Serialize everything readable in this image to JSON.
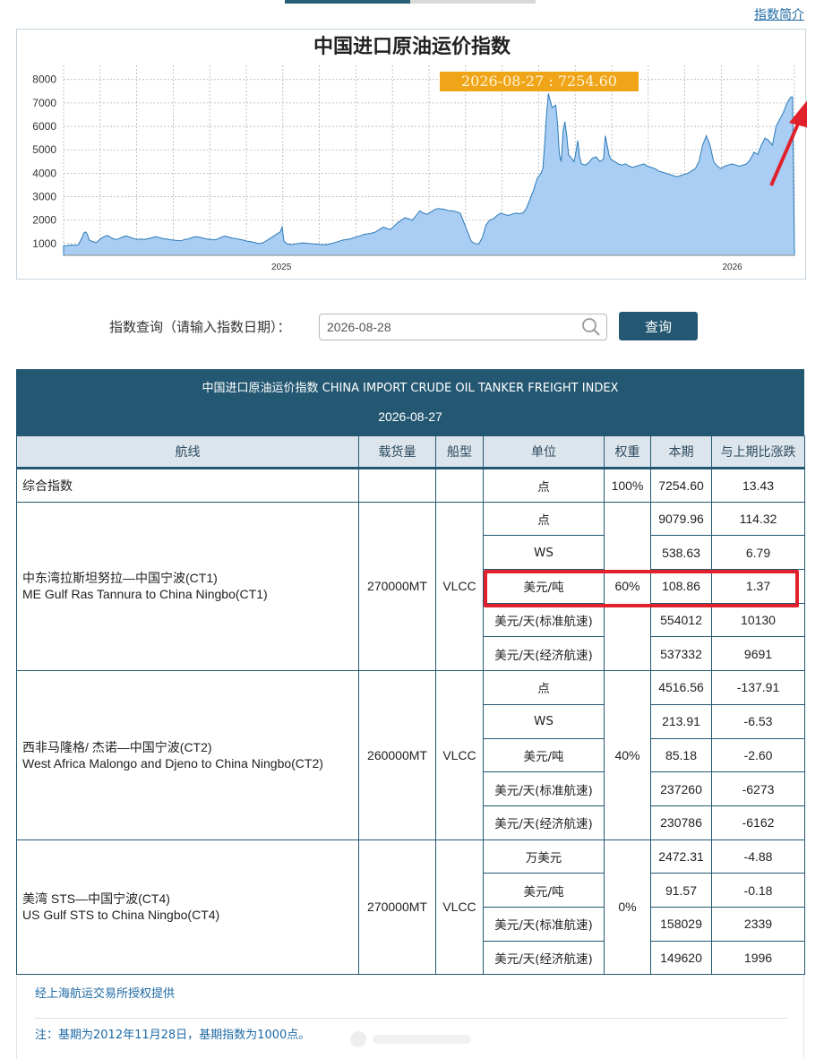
{
  "top": {
    "intro_link": "指数简介"
  },
  "chart_data": {
    "type": "area",
    "title": "中国进口原油运价指数",
    "yticks": [
      1000,
      2000,
      3000,
      4000,
      5000,
      6000,
      7000,
      8000
    ],
    "xticks": [
      "2025",
      "2026"
    ],
    "ylim": [
      500,
      8600
    ],
    "tooltip": "2026-08-27 : 7254.60",
    "fill_color": "#a9cdf3",
    "line_color": "#2b7bb9",
    "points": [
      [
        0,
        900
      ],
      [
        2,
        910
      ],
      [
        4,
        940
      ],
      [
        6,
        930
      ],
      [
        8,
        950
      ],
      [
        10,
        1250
      ],
      [
        11,
        1450
      ],
      [
        12,
        1500
      ],
      [
        13,
        1380
      ],
      [
        14,
        1150
      ],
      [
        16,
        1080
      ],
      [
        18,
        1050
      ],
      [
        20,
        1200
      ],
      [
        22,
        1300
      ],
      [
        24,
        1350
      ],
      [
        26,
        1250
      ],
      [
        28,
        1180
      ],
      [
        30,
        1200
      ],
      [
        32,
        1280
      ],
      [
        34,
        1330
      ],
      [
        36,
        1280
      ],
      [
        38,
        1220
      ],
      [
        40,
        1180
      ],
      [
        42,
        1200
      ],
      [
        44,
        1180
      ],
      [
        46,
        1210
      ],
      [
        48,
        1250
      ],
      [
        50,
        1300
      ],
      [
        52,
        1260
      ],
      [
        54,
        1220
      ],
      [
        56,
        1200
      ],
      [
        58,
        1170
      ],
      [
        60,
        1150
      ],
      [
        62,
        1130
      ],
      [
        64,
        1120
      ],
      [
        66,
        1180
      ],
      [
        68,
        1200
      ],
      [
        70,
        1260
      ],
      [
        72,
        1300
      ],
      [
        74,
        1270
      ],
      [
        76,
        1230
      ],
      [
        78,
        1200
      ],
      [
        80,
        1180
      ],
      [
        82,
        1160
      ],
      [
        84,
        1200
      ],
      [
        86,
        1280
      ],
      [
        88,
        1320
      ],
      [
        90,
        1280
      ],
      [
        92,
        1230
      ],
      [
        94,
        1210
      ],
      [
        96,
        1180
      ],
      [
        98,
        1150
      ],
      [
        100,
        1100
      ],
      [
        102,
        1080
      ],
      [
        104,
        1050
      ],
      [
        106,
        1000
      ],
      [
        108,
        1020
      ],
      [
        110,
        1100
      ],
      [
        112,
        1200
      ],
      [
        114,
        1300
      ],
      [
        116,
        1400
      ],
      [
        118,
        1500
      ],
      [
        119,
        1700
      ],
      [
        120,
        1100
      ],
      [
        122,
        980
      ],
      [
        124,
        960
      ],
      [
        126,
        980
      ],
      [
        128,
        1010
      ],
      [
        130,
        1030
      ],
      [
        132,
        1020
      ],
      [
        134,
        1000
      ],
      [
        136,
        990
      ],
      [
        138,
        980
      ],
      [
        140,
        960
      ],
      [
        142,
        950
      ],
      [
        144,
        970
      ],
      [
        146,
        1000
      ],
      [
        148,
        1050
      ],
      [
        150,
        1100
      ],
      [
        152,
        1150
      ],
      [
        154,
        1180
      ],
      [
        156,
        1200
      ],
      [
        158,
        1250
      ],
      [
        160,
        1300
      ],
      [
        162,
        1350
      ],
      [
        164,
        1400
      ],
      [
        166,
        1420
      ],
      [
        168,
        1450
      ],
      [
        170,
        1500
      ],
      [
        172,
        1600
      ],
      [
        174,
        1700
      ],
      [
        176,
        1650
      ],
      [
        178,
        1600
      ],
      [
        180,
        1750
      ],
      [
        182,
        1900
      ],
      [
        184,
        2000
      ],
      [
        186,
        2100
      ],
      [
        188,
        2050
      ],
      [
        190,
        2000
      ],
      [
        192,
        2200
      ],
      [
        194,
        2400
      ],
      [
        196,
        2300
      ],
      [
        198,
        2250
      ],
      [
        200,
        2350
      ],
      [
        202,
        2450
      ],
      [
        204,
        2500
      ],
      [
        206,
        2480
      ],
      [
        208,
        2450
      ],
      [
        210,
        2400
      ],
      [
        212,
        2400
      ],
      [
        214,
        2350
      ],
      [
        216,
        2300
      ],
      [
        218,
        1900
      ],
      [
        220,
        1500
      ],
      [
        222,
        1100
      ],
      [
        224,
        1000
      ],
      [
        226,
        980
      ],
      [
        228,
        1250
      ],
      [
        230,
        1800
      ],
      [
        232,
        2000
      ],
      [
        234,
        2050
      ],
      [
        236,
        2200
      ],
      [
        238,
        2300
      ],
      [
        240,
        2250
      ],
      [
        242,
        2200
      ],
      [
        244,
        2250
      ],
      [
        246,
        2300
      ],
      [
        248,
        2280
      ],
      [
        250,
        2300
      ],
      [
        252,
        2500
      ],
      [
        254,
        2900
      ],
      [
        256,
        3300
      ],
      [
        258,
        3800
      ],
      [
        260,
        4000
      ],
      [
        261,
        4200
      ],
      [
        262,
        5300
      ],
      [
        263,
        6500
      ],
      [
        264,
        7400
      ],
      [
        265,
        7100
      ],
      [
        266,
        6800
      ],
      [
        268,
        6900
      ],
      [
        269,
        6100
      ],
      [
        270,
        4800
      ],
      [
        271,
        4500
      ],
      [
        272,
        5800
      ],
      [
        273,
        6200
      ],
      [
        274,
        5600
      ],
      [
        275,
        4800
      ],
      [
        276,
        4700
      ],
      [
        278,
        4500
      ],
      [
        279,
        4900
      ],
      [
        280,
        5400
      ],
      [
        281,
        4700
      ],
      [
        282,
        4400
      ],
      [
        284,
        4350
      ],
      [
        286,
        4450
      ],
      [
        288,
        4650
      ],
      [
        290,
        4700
      ],
      [
        292,
        4500
      ],
      [
        294,
        4600
      ],
      [
        295,
        5600
      ],
      [
        296,
        5200
      ],
      [
        297,
        4800
      ],
      [
        298,
        4600
      ],
      [
        300,
        4500
      ],
      [
        302,
        4400
      ],
      [
        304,
        4350
      ],
      [
        306,
        4400
      ],
      [
        308,
        4300
      ],
      [
        310,
        4250
      ],
      [
        312,
        4300
      ],
      [
        314,
        4350
      ],
      [
        316,
        4400
      ],
      [
        318,
        4300
      ],
      [
        320,
        4250
      ],
      [
        322,
        4200
      ],
      [
        324,
        4100
      ],
      [
        326,
        4050
      ],
      [
        328,
        4000
      ],
      [
        330,
        3950
      ],
      [
        332,
        3900
      ],
      [
        334,
        3850
      ],
      [
        336,
        3900
      ],
      [
        338,
        3950
      ],
      [
        340,
        4000
      ],
      [
        342,
        4100
      ],
      [
        344,
        4200
      ],
      [
        346,
        4500
      ],
      [
        348,
        5200
      ],
      [
        350,
        5600
      ],
      [
        352,
        5200
      ],
      [
        354,
        4500
      ],
      [
        356,
        4300
      ],
      [
        358,
        4200
      ],
      [
        360,
        4300
      ],
      [
        362,
        4350
      ],
      [
        364,
        4400
      ],
      [
        366,
        4350
      ],
      [
        368,
        4300
      ],
      [
        370,
        4350
      ],
      [
        372,
        4400
      ],
      [
        374,
        4600
      ],
      [
        376,
        4900
      ],
      [
        378,
        4800
      ],
      [
        380,
        5200
      ],
      [
        382,
        5500
      ],
      [
        384,
        5400
      ],
      [
        386,
        5200
      ],
      [
        388,
        6000
      ],
      [
        390,
        6300
      ],
      [
        392,
        6600
      ],
      [
        394,
        7000
      ],
      [
        396,
        7250
      ],
      [
        397,
        7254.6
      ],
      [
        398,
        600
      ]
    ]
  },
  "query": {
    "label": "指数查询（请输入指数日期）：",
    "input_value": "2026-08-28",
    "button_label": "查询"
  },
  "table": {
    "title": "中国进口原油运价指数 CHINA IMPORT CRUDE OIL TANKER FREIGHT INDEX",
    "date": "2026-08-27",
    "headers": [
      "航线",
      "载货量",
      "船型",
      "单位",
      "权重",
      "本期",
      "与上期比涨跌"
    ],
    "composite": {
      "name": "综合指数",
      "unit": "点",
      "weight": "100%",
      "current": "7254.60",
      "change": "13.43"
    },
    "groups": [
      {
        "route_cn": "中东湾拉斯坦努拉—中国宁波(CT1)",
        "route_en": "ME Gulf Ras Tannura to China Ningbo(CT1)",
        "cargo": "270000MT",
        "ship": "VLCC",
        "weight": "60%",
        "rows": [
          {
            "unit": "点",
            "current": "9079.96",
            "change": "114.32"
          },
          {
            "unit": "WS",
            "current": "538.63",
            "change": "6.79"
          },
          {
            "unit": "美元/吨",
            "current": "108.86",
            "change": "1.37"
          },
          {
            "unit": "美元/天(标准航速)",
            "current": "554012",
            "change": "10130"
          },
          {
            "unit": "美元/天(经济航速)",
            "current": "537332",
            "change": "9691"
          }
        ]
      },
      {
        "route_cn": "西非马隆格/ 杰诺—中国宁波(CT2)",
        "route_en": "West Africa Malongo and Djeno to China Ningbo(CT2)",
        "cargo": "260000MT",
        "ship": "VLCC",
        "weight": "40%",
        "rows": [
          {
            "unit": "点",
            "current": "4516.56",
            "change": "-137.91"
          },
          {
            "unit": "WS",
            "current": "213.91",
            "change": "-6.53"
          },
          {
            "unit": "美元/吨",
            "current": "85.18",
            "change": "-2.60"
          },
          {
            "unit": "美元/天(标准航速)",
            "current": "237260",
            "change": "-6273"
          },
          {
            "unit": "美元/天(经济航速)",
            "current": "230786",
            "change": "-6162"
          }
        ]
      },
      {
        "route_cn": "美湾 STS—中国宁波(CT4)",
        "route_en": "US Gulf STS to China Ningbo(CT4)",
        "cargo": "270000MT",
        "ship": "VLCC",
        "weight": "0%",
        "rows": [
          {
            "unit": "万美元",
            "current": "2472.31",
            "change": "-4.88"
          },
          {
            "unit": "美元/吨",
            "current": "91.57",
            "change": "-0.18"
          },
          {
            "unit": "美元/天(标准航速)",
            "current": "158029",
            "change": "2339"
          },
          {
            "unit": "美元/天(经济航速)",
            "current": "149620",
            "change": "1996"
          }
        ]
      }
    ]
  },
  "footer": {
    "source": "经上海航运交易所授权提供",
    "note": "注：基期为2012年11月28日，基期指数为1000点。"
  },
  "colors": {
    "accent": "#245872",
    "highlight": "#e0212b",
    "link": "#1f6aa5"
  }
}
